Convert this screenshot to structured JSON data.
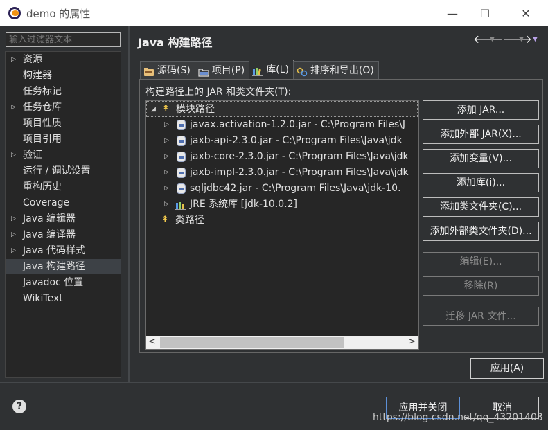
{
  "window": {
    "title": "demo 的属性",
    "minimize": "—",
    "maximize": "☐",
    "close": "✕"
  },
  "filter": {
    "placeholder": "输入过滤器文本"
  },
  "nav": {
    "items": [
      {
        "label": "资源",
        "expandable": true
      },
      {
        "label": "构建器",
        "expandable": false
      },
      {
        "label": "任务标记",
        "expandable": false
      },
      {
        "label": "任务仓库",
        "expandable": true
      },
      {
        "label": "项目性质",
        "expandable": false
      },
      {
        "label": "项目引用",
        "expandable": false
      },
      {
        "label": "验证",
        "expandable": true
      },
      {
        "label": "运行 / 调试设置",
        "expandable": false
      },
      {
        "label": "重构历史",
        "expandable": false
      },
      {
        "label": "Coverage",
        "expandable": false
      },
      {
        "label": "Java 编辑器",
        "expandable": true
      },
      {
        "label": "Java 编译器",
        "expandable": true
      },
      {
        "label": "Java 代码样式",
        "expandable": true
      },
      {
        "label": "Java 构建路径",
        "expandable": false,
        "selected": true
      },
      {
        "label": "Javadoc 位置",
        "expandable": false
      },
      {
        "label": "WikiText",
        "expandable": false
      }
    ]
  },
  "header": {
    "title": "Java 构建路径",
    "back": "🡐",
    "forward": "🡒",
    "dropdown": "▼"
  },
  "tabs": [
    {
      "label": "源码(S)",
      "icon": "source-folder-icon"
    },
    {
      "label": "项目(P)",
      "icon": "project-folder-icon"
    },
    {
      "label": "库(L)",
      "icon": "library-icon",
      "active": true
    },
    {
      "label": "排序和导出(O)",
      "icon": "order-export-icon"
    }
  ],
  "libraries": {
    "label": "构建路径上的 JAR 和类文件夹(T):",
    "module_path": "模块路径",
    "entries": [
      {
        "text": "javax.activation-1.2.0.jar  -  C:\\Program Files\\J",
        "icon": "jar-icon"
      },
      {
        "text": "jaxb-api-2.3.0.jar  -  C:\\Program Files\\Java\\jdk",
        "icon": "jar-icon"
      },
      {
        "text": "jaxb-core-2.3.0.jar  -  C:\\Program Files\\Java\\jdk",
        "icon": "jar-icon"
      },
      {
        "text": "jaxb-impl-2.3.0.jar  -  C:\\Program Files\\Java\\jdk",
        "icon": "jar-icon"
      },
      {
        "text": "sqljdbc42.jar  -  C:\\Program Files\\Java\\jdk-10.",
        "icon": "jar-icon"
      },
      {
        "text": "JRE 系统库 [jdk-10.0.2]",
        "icon": "jre-library-icon"
      }
    ],
    "class_path": "类路径"
  },
  "buttons": {
    "add_jar": "添加 JAR...",
    "add_external_jar": "添加外部 JAR(X)...",
    "add_variable": "添加变量(V)...",
    "add_library": "添加库(i)...",
    "add_class_folder": "添加类文件夹(C)...",
    "add_external_class_folder": "添加外部类文件夹(D)...",
    "edit": "编辑(E)...",
    "remove": "移除(R)",
    "migrate_jar": "迁移 JAR 文件...",
    "apply": "应用(A)",
    "apply_close": "应用并关闭",
    "cancel": "取消"
  },
  "watermark": "https://blog.csdn.net/qq_43201403",
  "colors": {
    "background": "#2f3133",
    "list_background": "#262626",
    "accent": "#5c8fd6",
    "path_icon": "#f2c94c"
  }
}
